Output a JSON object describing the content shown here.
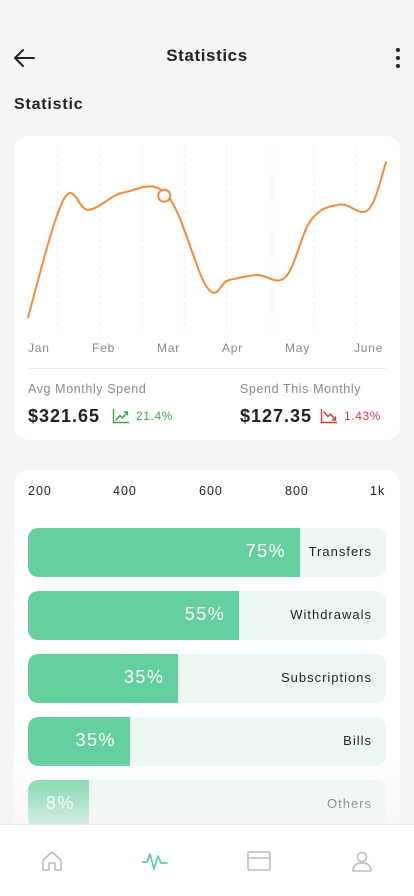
{
  "header": {
    "title": "Statistics"
  },
  "section": {
    "title": "Statistic"
  },
  "chart_data": {
    "type": "line",
    "categories": [
      "Jan",
      "Feb",
      "Mar",
      "Apr",
      "May",
      "June"
    ],
    "x": [
      0,
      0.5,
      1,
      1.5,
      2,
      2.5,
      3,
      3.5,
      4,
      4.5,
      5
    ],
    "values": [
      5,
      72,
      68,
      78,
      20,
      28,
      26,
      60,
      67,
      95
    ],
    "series": [
      {
        "x": [
          0,
          0.5,
          0.85,
          1.35,
          1.95,
          2.5,
          2.8,
          3.2,
          3.6,
          3.95,
          4.35,
          4.75,
          5.0
        ],
        "values": [
          5,
          72,
          66,
          76,
          74,
          22,
          26,
          29,
          28,
          60,
          69,
          66,
          93
        ]
      }
    ],
    "highlight_point": {
      "x": 2.0,
      "value": 74
    },
    "ylim": [
      0,
      100
    ],
    "grid": "vertical dashed",
    "line_color": "#f28c3a"
  },
  "summary": {
    "avg_label": "Avg Monthly Spend",
    "avg_value": "$321.65",
    "avg_change": "21.4%",
    "this_label": "Spend This Monthly",
    "this_value": "$127.35",
    "this_change": "1.43%",
    "up_color": "#3aa648",
    "down_color": "#d23c3c"
  },
  "bars": {
    "axis": [
      "200",
      "400",
      "600",
      "800",
      "1k"
    ],
    "items": [
      {
        "pct": "75%",
        "name": "Transfers",
        "fraction": 0.76
      },
      {
        "pct": "55%",
        "name": "Withdrawals",
        "fraction": 0.59
      },
      {
        "pct": "35%",
        "name": "Subscriptions",
        "fraction": 0.42
      },
      {
        "pct": "35%",
        "name": "Bills",
        "fraction": 0.285
      },
      {
        "pct": "8%",
        "name": "Others",
        "fraction": 0.17
      }
    ],
    "fill_color": "#64cf9f",
    "track_color": "#edf7f2"
  },
  "tabbar": {
    "items": [
      "home-icon",
      "activity-icon",
      "card-icon",
      "profile-icon"
    ],
    "active": "activity-icon",
    "active_color": "#64cf9f",
    "inactive_color": "#bdbdbd"
  }
}
